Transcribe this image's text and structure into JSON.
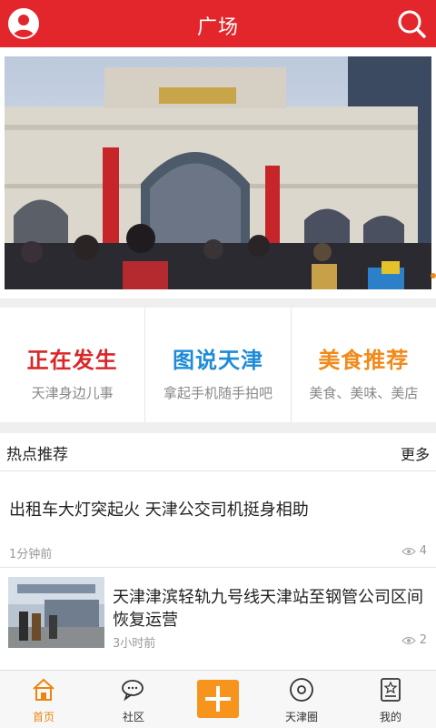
{
  "header": {
    "title": "广场",
    "avatar_icon": "user-avatar-icon",
    "search_icon": "search-icon"
  },
  "categories": [
    {
      "title": "正在发生",
      "subtitle": "天津身边儿事",
      "color": "#d9262b"
    },
    {
      "title": "图说天津",
      "subtitle": "拿起手机随手拍吧",
      "color": "#1e8bd6"
    },
    {
      "title": "美食推荐",
      "subtitle": "美食、美味、美店",
      "color": "#f08a1a"
    }
  ],
  "hot": {
    "title": "热点推荐",
    "more_label": "更多"
  },
  "news": [
    {
      "title": "出租车大灯突起火 天津公交司机挺身相助",
      "time": "1分钟前",
      "views": "4"
    },
    {
      "title": "天津津滨轻轨九号线天津站至钢管公司区间恢复运营",
      "time": "3小时前",
      "views": "2"
    }
  ],
  "nav": [
    {
      "label": "首页",
      "icon": "home-icon",
      "active": true
    },
    {
      "label": "社区",
      "icon": "chat-bubbles-icon"
    },
    {
      "label": "",
      "icon": "plus-icon"
    },
    {
      "label": "天津圈",
      "icon": "disc-icon"
    },
    {
      "label": "我的",
      "icon": "profile-card-icon"
    }
  ],
  "colors": {
    "header": "#e3262b",
    "accent": "#f7941d",
    "active_nav": "#e8870f"
  }
}
